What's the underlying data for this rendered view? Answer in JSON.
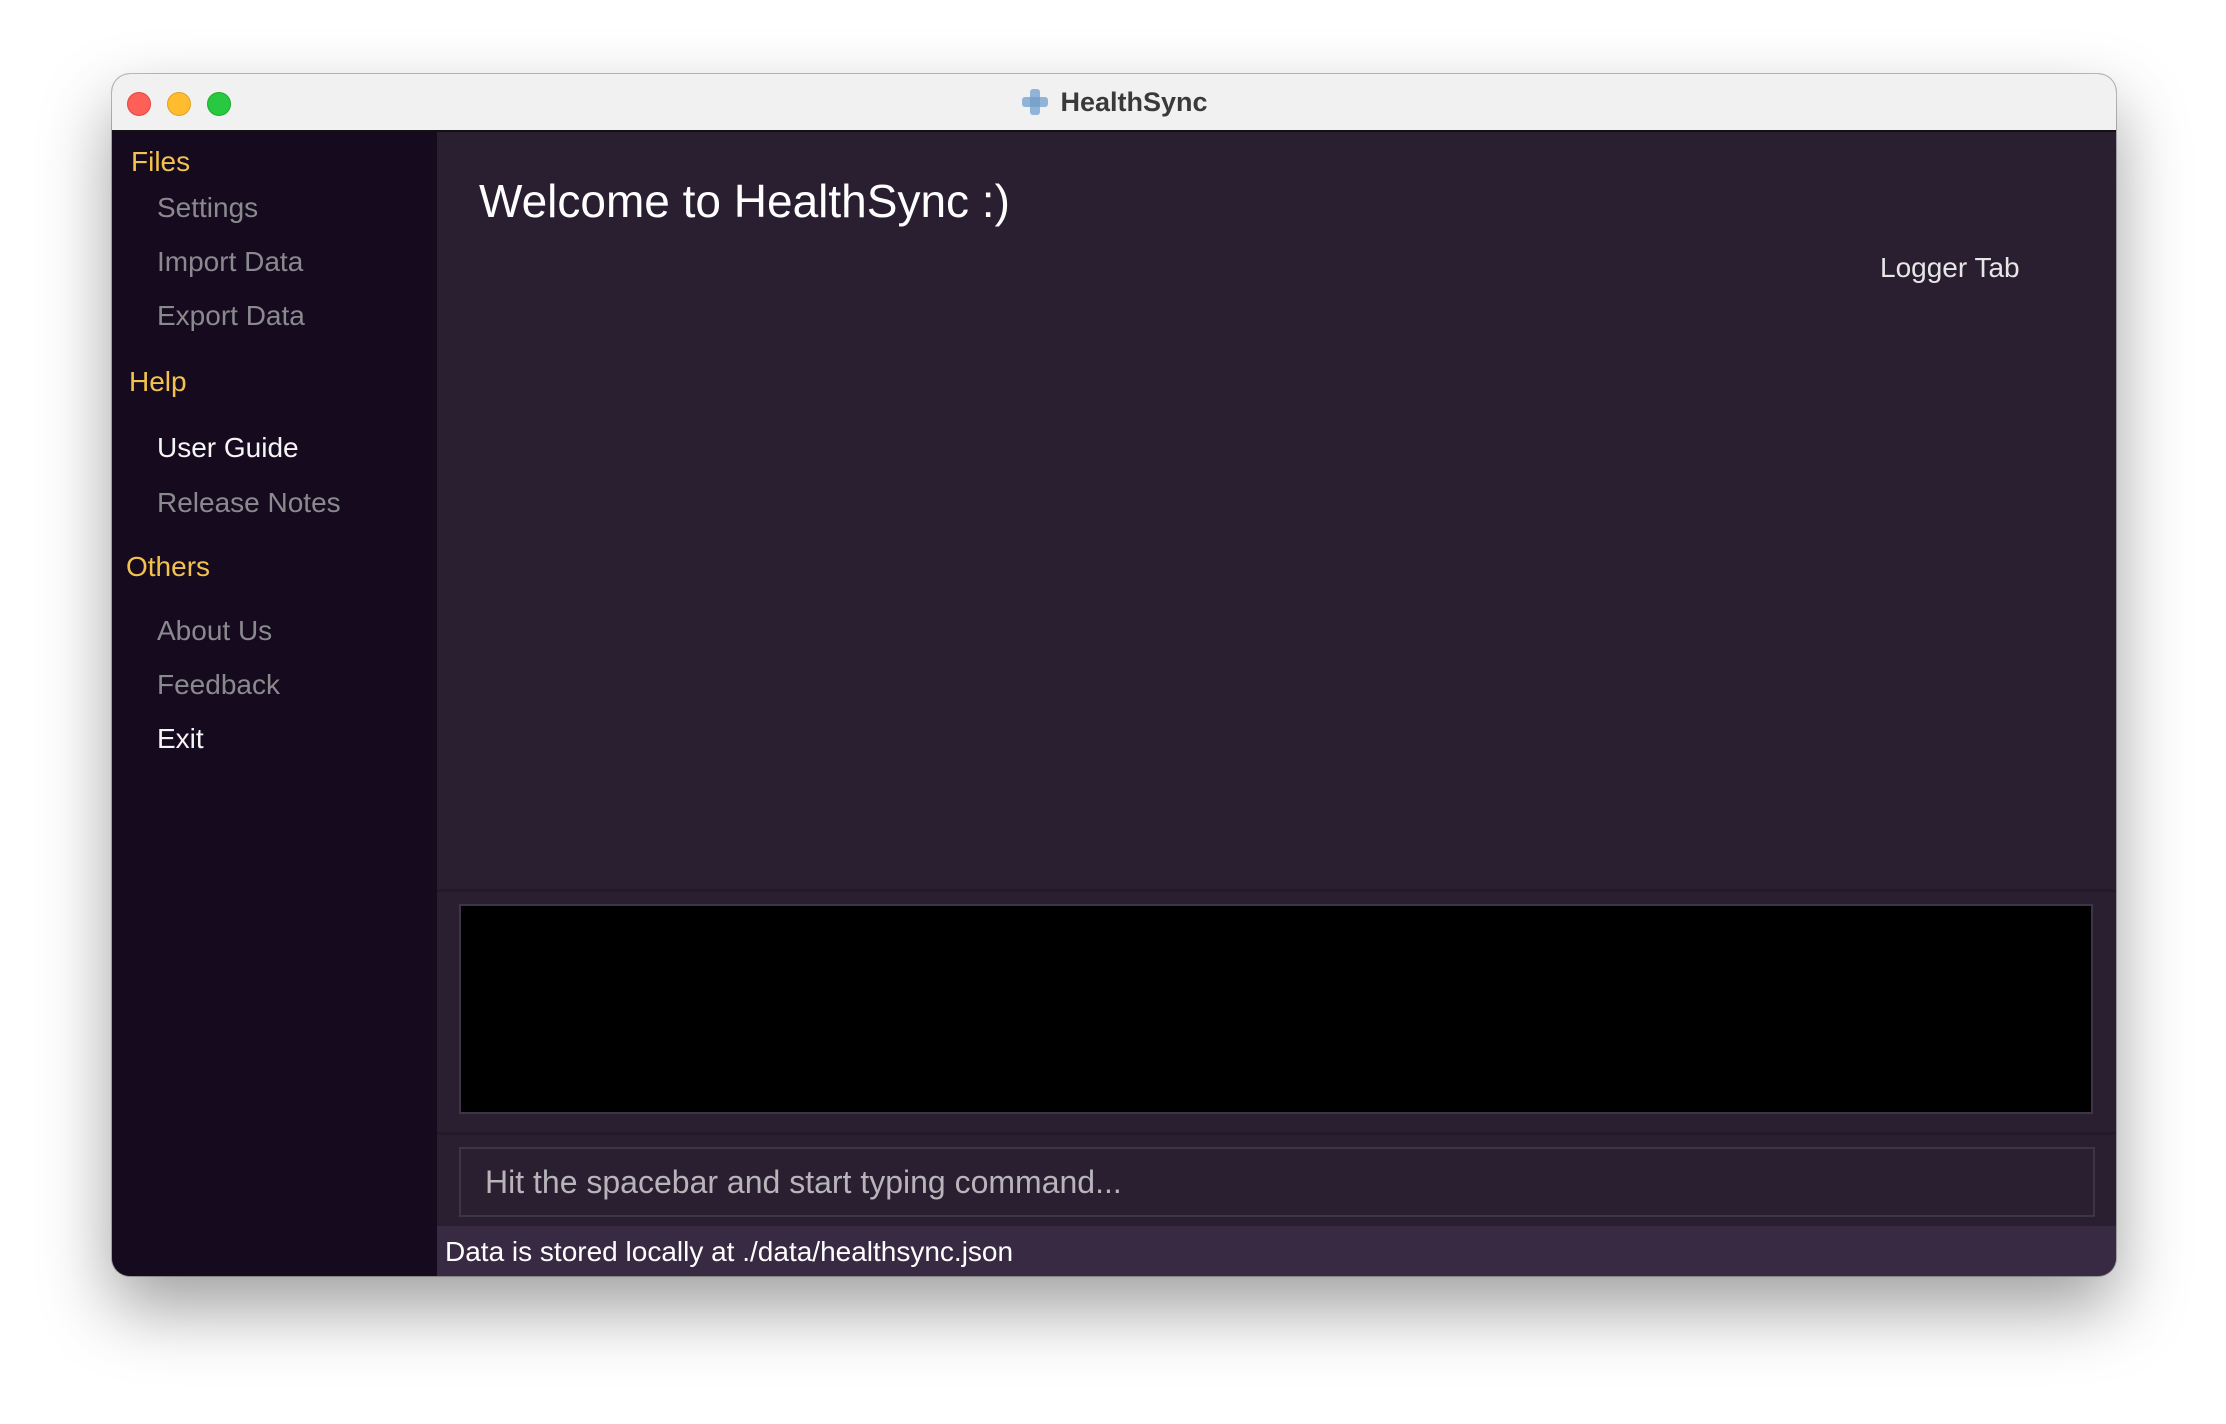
{
  "window": {
    "title": "HealthSync",
    "icon": "medical-cross-icon"
  },
  "sidebar": {
    "sections": [
      {
        "label": "Files",
        "items": [
          {
            "label": "Settings",
            "state": "dim"
          },
          {
            "label": "Import Data",
            "state": "dim"
          },
          {
            "label": "Export Data",
            "state": "dim"
          }
        ]
      },
      {
        "label": "Help",
        "items": [
          {
            "label": "User Guide",
            "state": "bright"
          },
          {
            "label": "Release Notes",
            "state": "dim"
          }
        ]
      },
      {
        "label": "Others",
        "items": [
          {
            "label": "About Us",
            "state": "dim"
          },
          {
            "label": "Feedback",
            "state": "dim"
          },
          {
            "label": "Exit",
            "state": "bright"
          }
        ]
      }
    ]
  },
  "main": {
    "welcome": "Welcome to HealthSync :)",
    "logger_tab": "Logger Tab"
  },
  "result_display": {
    "text": ""
  },
  "command": {
    "value": "",
    "placeholder": "Hit the spacebar and start typing command..."
  },
  "status": {
    "text": "Data is stored locally at ./data/healthsync.json"
  },
  "colors": {
    "accent": "#f2c14e",
    "sidebar_bg": "#160a1f",
    "main_bg": "#2a1f31",
    "status_bg": "#372a42"
  }
}
